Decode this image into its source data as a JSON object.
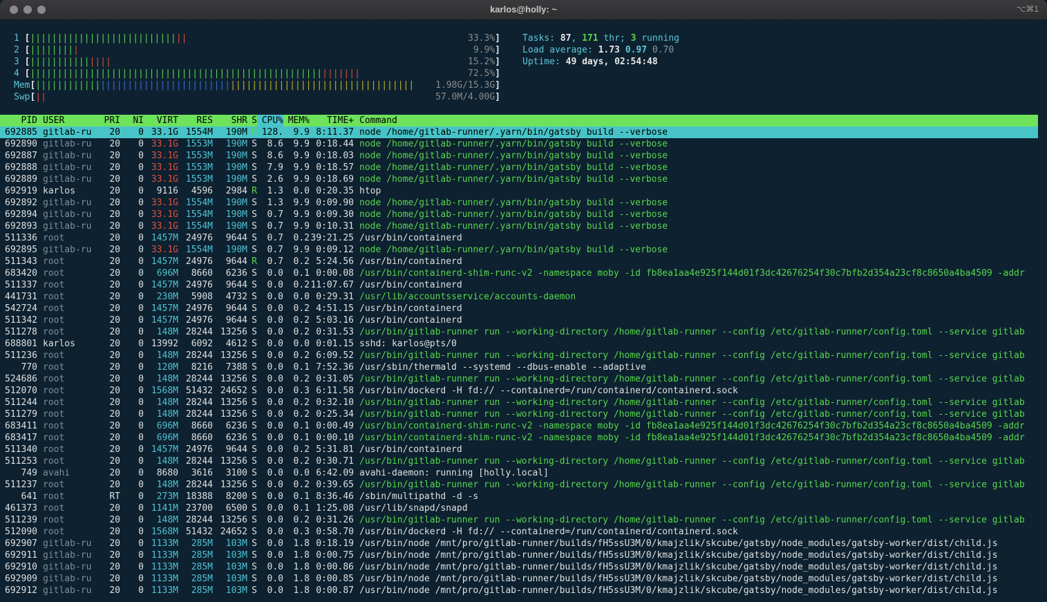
{
  "window": {
    "title": "karlos@holly: ~",
    "shortcut": "⌥⌘1"
  },
  "meters": {
    "cpus": [
      {
        "label": "1",
        "bars": "|||||||||||||||||||||||||||",
        "red": "||",
        "pct": "33.3%"
      },
      {
        "label": "2",
        "bars": "||||||||",
        "red": "|",
        "pct": "9.9%"
      },
      {
        "label": "3",
        "bars": "|||||||||||",
        "red": "||||",
        "pct": "15.2%"
      },
      {
        "label": "4",
        "bars": "||||||||||||||||||||||||||||||||||||||||||||||||||||||",
        "red": "|||||||",
        "pct": "72.5%"
      }
    ],
    "mem": {
      "label": "Mem",
      "green": "||||||||||||",
      "blue": "||||||||||||||||||||||||",
      "yellow": "||||||||||||||||||||||||||||||||||",
      "value": "1.98G/15.3G"
    },
    "swp": {
      "label": "Swp",
      "red": "||",
      "value": "57.0M/4.00G"
    }
  },
  "info": {
    "tasks_label": "Tasks: ",
    "tasks": "87",
    "thr_sep": ", ",
    "thr": "171",
    "thr_label": " thr; ",
    "running": "3",
    "running_label": " running",
    "load_label": "Load average: ",
    "load1": "1.73",
    "load5": "0.97",
    "load15": "0.70",
    "uptime_label": "Uptime: ",
    "uptime": "49 days, 02:54:48"
  },
  "table": {
    "headers": [
      "PID",
      "USER",
      "PRI",
      "NI",
      "VIRT",
      "RES",
      "SHR",
      "S",
      "CPU%",
      "MEM%",
      "TIME+",
      "Command"
    ],
    "rows": [
      [
        "692885",
        "gitlab-ru",
        "20",
        "0",
        "33.1G",
        "1554M",
        "190M",
        "R",
        "128.",
        "9.9",
        "8:11.37",
        "node /home/gitlab-runner/.yarn/bin/gatsby build --verbose"
      ],
      [
        "692890",
        "gitlab-ru",
        "20",
        "0",
        "33.1G",
        "1553M",
        "190M",
        "S",
        "8.6",
        "9.9",
        "0:18.44",
        "node /home/gitlab-runner/.yarn/bin/gatsby build --verbose"
      ],
      [
        "692887",
        "gitlab-ru",
        "20",
        "0",
        "33.1G",
        "1553M",
        "190M",
        "S",
        "8.6",
        "9.9",
        "0:18.03",
        "node /home/gitlab-runner/.yarn/bin/gatsby build --verbose"
      ],
      [
        "692888",
        "gitlab-ru",
        "20",
        "0",
        "33.1G",
        "1553M",
        "190M",
        "S",
        "7.9",
        "9.9",
        "0:18.57",
        "node /home/gitlab-runner/.yarn/bin/gatsby build --verbose"
      ],
      [
        "692889",
        "gitlab-ru",
        "20",
        "0",
        "33.1G",
        "1553M",
        "190M",
        "S",
        "2.6",
        "9.9",
        "0:18.69",
        "node /home/gitlab-runner/.yarn/bin/gatsby build --verbose"
      ],
      [
        "692919",
        "karlos",
        "20",
        "0",
        "9116",
        "4596",
        "2984",
        "R",
        "1.3",
        "0.0",
        "0:20.35",
        "htop"
      ],
      [
        "692892",
        "gitlab-ru",
        "20",
        "0",
        "33.1G",
        "1554M",
        "190M",
        "S",
        "1.3",
        "9.9",
        "0:09.90",
        "node /home/gitlab-runner/.yarn/bin/gatsby build --verbose"
      ],
      [
        "692894",
        "gitlab-ru",
        "20",
        "0",
        "33.1G",
        "1554M",
        "190M",
        "S",
        "0.7",
        "9.9",
        "0:09.30",
        "node /home/gitlab-runner/.yarn/bin/gatsby build --verbose"
      ],
      [
        "692893",
        "gitlab-ru",
        "20",
        "0",
        "33.1G",
        "1554M",
        "190M",
        "S",
        "0.7",
        "9.9",
        "0:10.31",
        "node /home/gitlab-runner/.yarn/bin/gatsby build --verbose"
      ],
      [
        "511336",
        "root",
        "20",
        "0",
        "1457M",
        "24976",
        "9644",
        "S",
        "0.7",
        "0.2",
        "39:21.25",
        "/usr/bin/containerd"
      ],
      [
        "692895",
        "gitlab-ru",
        "20",
        "0",
        "33.1G",
        "1554M",
        "190M",
        "S",
        "0.7",
        "9.9",
        "0:09.12",
        "node /home/gitlab-runner/.yarn/bin/gatsby build --verbose"
      ],
      [
        "511343",
        "root",
        "20",
        "0",
        "1457M",
        "24976",
        "9644",
        "R",
        "0.7",
        "0.2",
        "5:24.56",
        "/usr/bin/containerd"
      ],
      [
        "683420",
        "root",
        "20",
        "0",
        "696M",
        "8660",
        "6236",
        "S",
        "0.0",
        "0.1",
        "0:00.08",
        "/usr/bin/containerd-shim-runc-v2 -namespace moby -id fb8ea1aa4e925f144d01f3dc42676254f30c7bfb2d354a23cf8c8650a4ba4509 -addr"
      ],
      [
        "511337",
        "root",
        "20",
        "0",
        "1457M",
        "24976",
        "9644",
        "S",
        "0.0",
        "0.2",
        "11:07.67",
        "/usr/bin/containerd"
      ],
      [
        "441731",
        "root",
        "20",
        "0",
        "230M",
        "5908",
        "4732",
        "S",
        "0.0",
        "0.0",
        "0:29.31",
        "/usr/lib/accountsservice/accounts-daemon"
      ],
      [
        "542724",
        "root",
        "20",
        "0",
        "1457M",
        "24976",
        "9644",
        "S",
        "0.0",
        "0.2",
        "4:51.15",
        "/usr/bin/containerd"
      ],
      [
        "511342",
        "root",
        "20",
        "0",
        "1457M",
        "24976",
        "9644",
        "S",
        "0.0",
        "0.2",
        "5:03.16",
        "/usr/bin/containerd"
      ],
      [
        "511278",
        "root",
        "20",
        "0",
        "148M",
        "28244",
        "13256",
        "S",
        "0.0",
        "0.2",
        "0:31.53",
        "/usr/bin/gitlab-runner run --working-directory /home/gitlab-runner --config /etc/gitlab-runner/config.toml --service gitlab"
      ],
      [
        "688801",
        "karlos",
        "20",
        "0",
        "13992",
        "6092",
        "4612",
        "S",
        "0.0",
        "0.0",
        "0:01.15",
        "sshd: karlos@pts/0"
      ],
      [
        "511236",
        "root",
        "20",
        "0",
        "148M",
        "28244",
        "13256",
        "S",
        "0.0",
        "0.2",
        "6:09.52",
        "/usr/bin/gitlab-runner run --working-directory /home/gitlab-runner --config /etc/gitlab-runner/config.toml --service gitlab"
      ],
      [
        "770",
        "root",
        "20",
        "0",
        "120M",
        "8216",
        "7388",
        "S",
        "0.0",
        "0.1",
        "7:52.36",
        "/usr/sbin/thermald --systemd --dbus-enable --adaptive"
      ],
      [
        "524686",
        "root",
        "20",
        "0",
        "148M",
        "28244",
        "13256",
        "S",
        "0.0",
        "0.2",
        "0:31.05",
        "/usr/bin/gitlab-runner run --working-directory /home/gitlab-runner --config /etc/gitlab-runner/config.toml --service gitlab"
      ],
      [
        "512070",
        "root",
        "20",
        "0",
        "1568M",
        "51432",
        "24652",
        "S",
        "0.0",
        "0.3",
        "6:11.58",
        "/usr/bin/dockerd -H fd:// --containerd=/run/containerd/containerd.sock"
      ],
      [
        "511244",
        "root",
        "20",
        "0",
        "148M",
        "28244",
        "13256",
        "S",
        "0.0",
        "0.2",
        "0:32.10",
        "/usr/bin/gitlab-runner run --working-directory /home/gitlab-runner --config /etc/gitlab-runner/config.toml --service gitlab"
      ],
      [
        "511279",
        "root",
        "20",
        "0",
        "148M",
        "28244",
        "13256",
        "S",
        "0.0",
        "0.2",
        "0:25.34",
        "/usr/bin/gitlab-runner run --working-directory /home/gitlab-runner --config /etc/gitlab-runner/config.toml --service gitlab"
      ],
      [
        "683411",
        "root",
        "20",
        "0",
        "696M",
        "8660",
        "6236",
        "S",
        "0.0",
        "0.1",
        "0:00.49",
        "/usr/bin/containerd-shim-runc-v2 -namespace moby -id fb8ea1aa4e925f144d01f3dc42676254f30c7bfb2d354a23cf8c8650a4ba4509 -addr"
      ],
      [
        "683417",
        "root",
        "20",
        "0",
        "696M",
        "8660",
        "6236",
        "S",
        "0.0",
        "0.1",
        "0:00.10",
        "/usr/bin/containerd-shim-runc-v2 -namespace moby -id fb8ea1aa4e925f144d01f3dc42676254f30c7bfb2d354a23cf8c8650a4ba4509 -addr"
      ],
      [
        "511340",
        "root",
        "20",
        "0",
        "1457M",
        "24976",
        "9644",
        "S",
        "0.0",
        "0.2",
        "5:31.81",
        "/usr/bin/containerd"
      ],
      [
        "511253",
        "root",
        "20",
        "0",
        "148M",
        "28244",
        "13256",
        "S",
        "0.0",
        "0.2",
        "0:30.71",
        "/usr/bin/gitlab-runner run --working-directory /home/gitlab-runner --config /etc/gitlab-runner/config.toml --service gitlab"
      ],
      [
        "749",
        "avahi",
        "20",
        "0",
        "8680",
        "3616",
        "3100",
        "S",
        "0.0",
        "0.0",
        "6:42.09",
        "avahi-daemon: running [holly.local]"
      ],
      [
        "511237",
        "root",
        "20",
        "0",
        "148M",
        "28244",
        "13256",
        "S",
        "0.0",
        "0.2",
        "0:39.65",
        "/usr/bin/gitlab-runner run --working-directory /home/gitlab-runner --config /etc/gitlab-runner/config.toml --service gitlab"
      ],
      [
        "641",
        "root",
        "RT",
        "0",
        "273M",
        "18388",
        "8200",
        "S",
        "0.0",
        "0.1",
        "8:36.46",
        "/sbin/multipathd -d -s"
      ],
      [
        "461373",
        "root",
        "20",
        "0",
        "1141M",
        "23700",
        "6500",
        "S",
        "0.0",
        "0.1",
        "1:25.08",
        "/usr/lib/snapd/snapd"
      ],
      [
        "511239",
        "root",
        "20",
        "0",
        "148M",
        "28244",
        "13256",
        "S",
        "0.0",
        "0.2",
        "0:31.26",
        "/usr/bin/gitlab-runner run --working-directory /home/gitlab-runner --config /etc/gitlab-runner/config.toml --service gitlab"
      ],
      [
        "512090",
        "root",
        "20",
        "0",
        "1568M",
        "51432",
        "24652",
        "S",
        "0.0",
        "0.3",
        "0:58.70",
        "/usr/bin/dockerd -H fd:// --containerd=/run/containerd/containerd.sock"
      ],
      [
        "692907",
        "gitlab-ru",
        "20",
        "0",
        "1133M",
        "285M",
        "103M",
        "S",
        "0.0",
        "1.8",
        "0:18.19",
        "/usr/bin/node /mnt/pro/gitlab-runner/builds/fH5ssU3M/0/kmajzlik/skcube/gatsby/node_modules/gatsby-worker/dist/child.js"
      ],
      [
        "692911",
        "gitlab-ru",
        "20",
        "0",
        "1133M",
        "285M",
        "103M",
        "S",
        "0.0",
        "1.8",
        "0:00.75",
        "/usr/bin/node /mnt/pro/gitlab-runner/builds/fH5ssU3M/0/kmajzlik/skcube/gatsby/node_modules/gatsby-worker/dist/child.js"
      ],
      [
        "692910",
        "gitlab-ru",
        "20",
        "0",
        "1133M",
        "285M",
        "103M",
        "S",
        "0.0",
        "1.8",
        "0:00.86",
        "/usr/bin/node /mnt/pro/gitlab-runner/builds/fH5ssU3M/0/kmajzlik/skcube/gatsby/node_modules/gatsby-worker/dist/child.js"
      ],
      [
        "692909",
        "gitlab-ru",
        "20",
        "0",
        "1133M",
        "285M",
        "103M",
        "S",
        "0.0",
        "1.8",
        "0:00.85",
        "/usr/bin/node /mnt/pro/gitlab-runner/builds/fH5ssU3M/0/kmajzlik/skcube/gatsby/node_modules/gatsby-worker/dist/child.js"
      ],
      [
        "692912",
        "gitlab-ru",
        "20",
        "0",
        "1133M",
        "285M",
        "103M",
        "S",
        "0.0",
        "1.8",
        "0:00.87",
        "/usr/bin/node /mnt/pro/gitlab-runner/builds/fH5ssU3M/0/kmajzlik/skcube/gatsby/node_modules/gatsby-worker/dist/child.js"
      ]
    ]
  }
}
